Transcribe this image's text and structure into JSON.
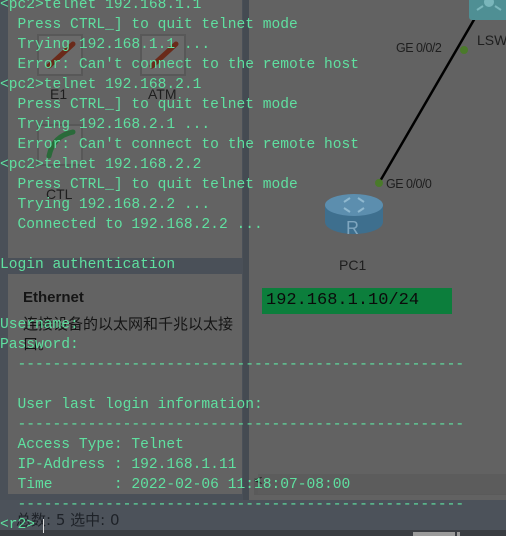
{
  "palette": {
    "devices": [
      {
        "label": "E1",
        "icon": "e1-cable-icon"
      },
      {
        "label": "ATM",
        "icon": "atm-cable-icon"
      },
      {
        "label": "CTL",
        "icon": "ctl-cable-icon"
      }
    ],
    "description": {
      "title": "Ethernet",
      "body": "连接设备的以太网和千兆以太接口。"
    }
  },
  "topology": {
    "devices": [
      {
        "name": "LSW",
        "type": "switch"
      },
      {
        "name": "PC1",
        "type": "router"
      }
    ],
    "ports": [
      {
        "label": "GE 0/0/2",
        "device": "LSW"
      },
      {
        "label": "GE 0/0/0",
        "device": "PC1"
      }
    ],
    "ip_badge": "192.168.1.10/24",
    "link_color": "#000000",
    "port_dot_color": "#4a7a2a"
  },
  "terminal": {
    "lines": [
      "<pc2>telnet 192.168.1.1",
      "  Press CTRL_] to quit telnet mode",
      "  Trying 192.168.1.1 ...",
      "  Error: Can't connect to the remote host",
      "<pc2>telnet 192.168.2.1",
      "  Press CTRL_] to quit telnet mode",
      "  Trying 192.168.2.1 ...",
      "  Error: Can't connect to the remote host",
      "<pc2>telnet 192.168.2.2",
      "  Press CTRL_] to quit telnet mode",
      "  Trying 192.168.2.2 ...",
      "  Connected to 192.168.2.2 ...",
      "",
      "Login authentication",
      "",
      "",
      "Username:",
      "Password:",
      "  ---------------------------------------------------",
      "",
      "  User last login information:",
      "  ---------------------------------------------------",
      "  Access Type: Telnet",
      "  IP-Address : 192.168.1.11",
      "  Time       : 2022-02-06 11:18:07-08:00",
      "  ---------------------------------------------------",
      "<r2>"
    ],
    "text_color": "#5fe0a0"
  },
  "status_bar": {
    "text": "总数: 5 选中: 0"
  }
}
